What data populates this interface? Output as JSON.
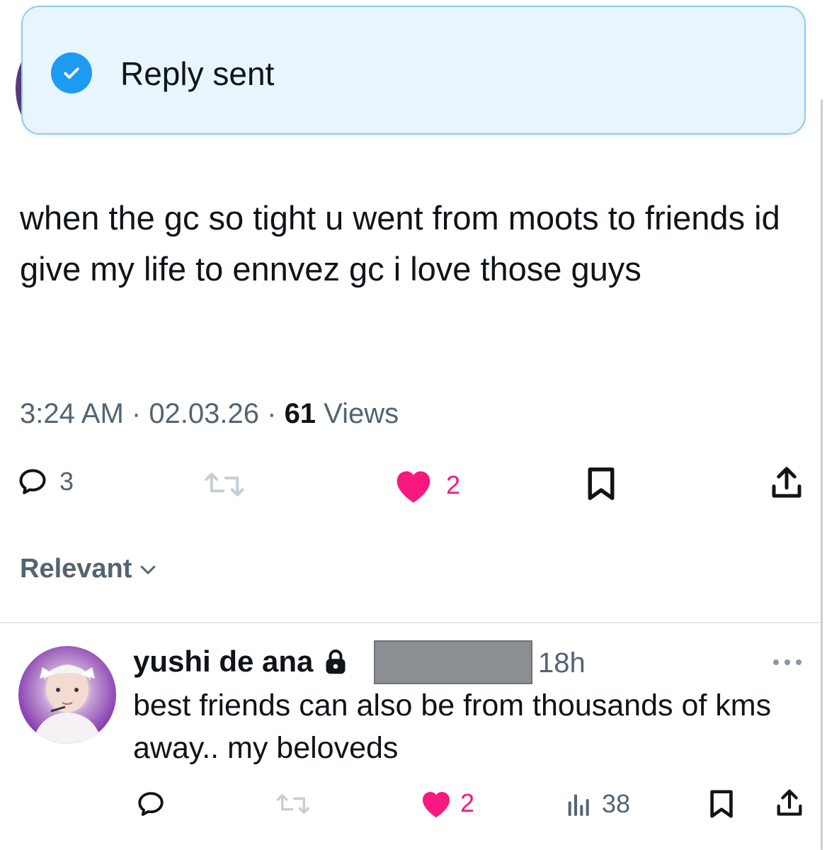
{
  "toast": {
    "message": "Reply sent",
    "check_icon": "check-circle-icon"
  },
  "tweet": {
    "text": "when the gc so tight u went from moots to friends id give my life to ennvez gc i love those guys",
    "time": "3:24 AM",
    "sep1": " · ",
    "date": "02.03.26",
    "sep2": " · ",
    "views_count": "61",
    "views_label": " Views",
    "actions": {
      "replies": "3",
      "retweets": "",
      "likes": "2"
    }
  },
  "sort": {
    "label": "Relevant"
  },
  "reply": {
    "name": "yushi de ana",
    "time": "18h",
    "text": "best friends can also be from thousands of kms away.. my beloveds",
    "actions": {
      "replies": "",
      "retweets": "",
      "likes": "2",
      "views": "38"
    }
  },
  "colors": {
    "accent": "#1d9bf0",
    "like": "#f91880",
    "muted": "#536471",
    "toast_bg": "#e8f5fd"
  }
}
